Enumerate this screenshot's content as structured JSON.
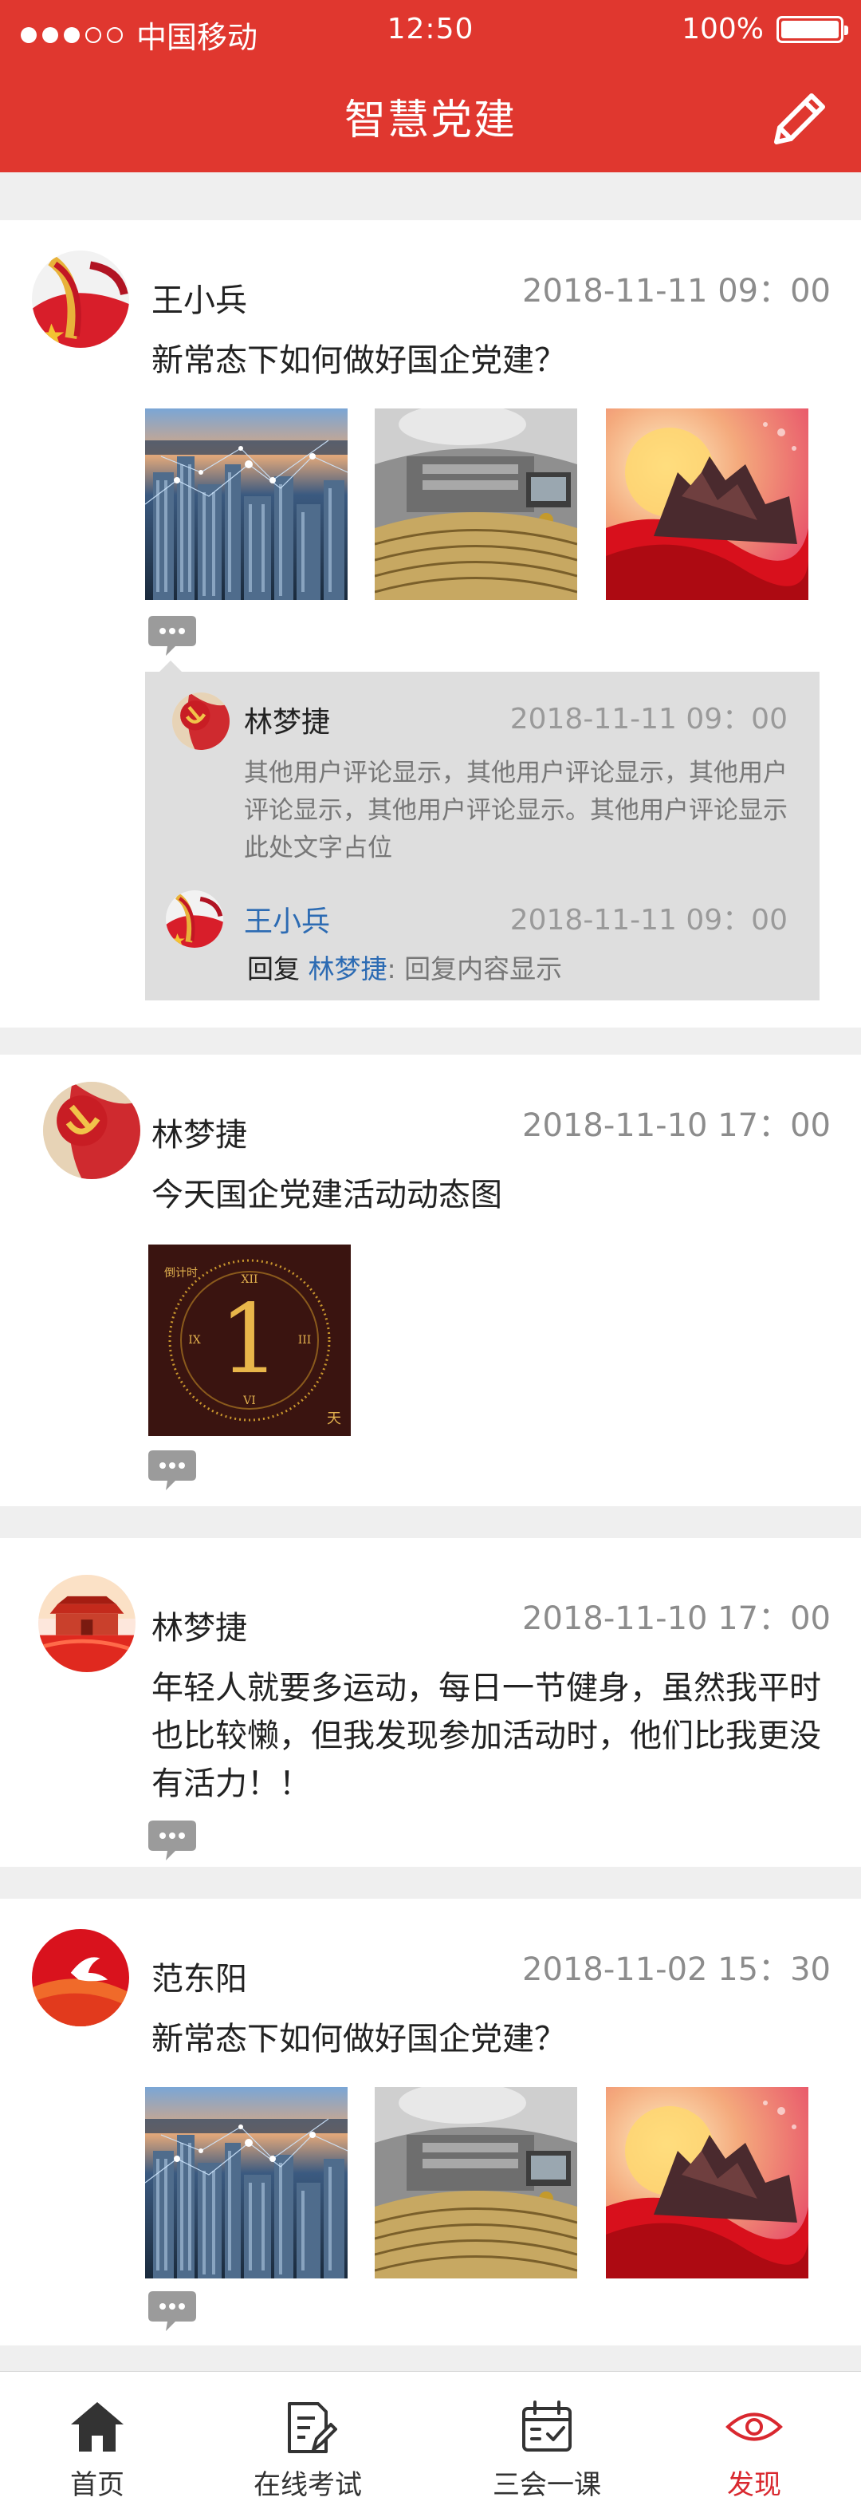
{
  "status_bar": {
    "carrier": "中国移动",
    "time": "12:50",
    "battery": "100%"
  },
  "header": {
    "title": "智慧党建"
  },
  "posts": [
    {
      "username": "王小兵",
      "time": "2018-11-11 09：00",
      "text": "新常态下如何做好国企党建？",
      "comments": [
        {
          "username": "林梦捷",
          "time": "2018-11-11 09：00",
          "text": "其他用户评论显示，其他用户评论显示，其他用户评论显示，其他用户评论显示。其他用户评论显示此处文字占位"
        },
        {
          "username": "王小兵",
          "time": "2018-11-11 09：00",
          "reply_word": "回复",
          "reply_target": "林梦捷",
          "reply_text": ": 回复内容显示"
        }
      ]
    },
    {
      "username": "林梦捷",
      "time": "2018-11-10 17：00",
      "text": "今天国企党建活动动态图",
      "countdown_label": "倒计时",
      "countdown_number": "1",
      "countdown_unit": "天"
    },
    {
      "username": "林梦捷",
      "time": "2018-11-10 17：00",
      "text": "年轻人就要多运动，每日一节健身，虽然我平时也比较懒，但我发现参加活动时，他们比我更没有活力！！"
    },
    {
      "username": "范东阳",
      "time": "2018-11-02 15：30",
      "text": "新常态下如何做好国企党建？"
    }
  ],
  "tabbar": {
    "items": [
      {
        "label": "首页",
        "icon": "home-icon"
      },
      {
        "label": "在线考试",
        "icon": "exam-icon"
      },
      {
        "label": "三会一课",
        "icon": "calendar-icon"
      },
      {
        "label": "发现",
        "icon": "eye-icon"
      }
    ],
    "active_color": "#d9282f"
  },
  "colors": {
    "brand_red": "#e0372f",
    "link_blue": "#2c6bb3"
  }
}
